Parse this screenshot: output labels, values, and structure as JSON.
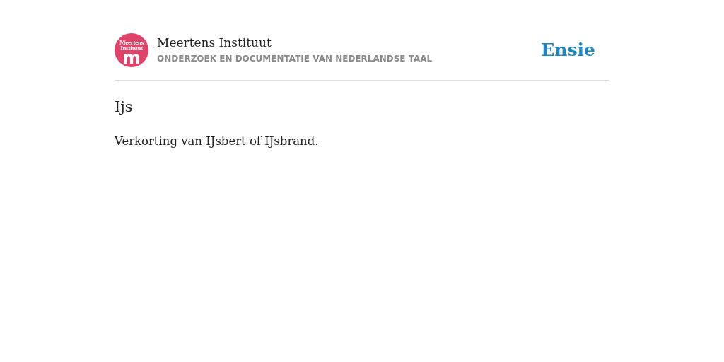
{
  "header": {
    "logo": {
      "lines": [
        "Meertens",
        "Instituut"
      ],
      "mark": "m"
    },
    "title": "Meertens Instituut",
    "subtitle": "ONDERZOEK EN DOCUMENTATIE VAN NEDERLANDSE TAAL",
    "brand": "Ensie"
  },
  "entry": {
    "heading": "Ijs",
    "definition": "Verkorting van IJsbert of IJsbrand."
  }
}
